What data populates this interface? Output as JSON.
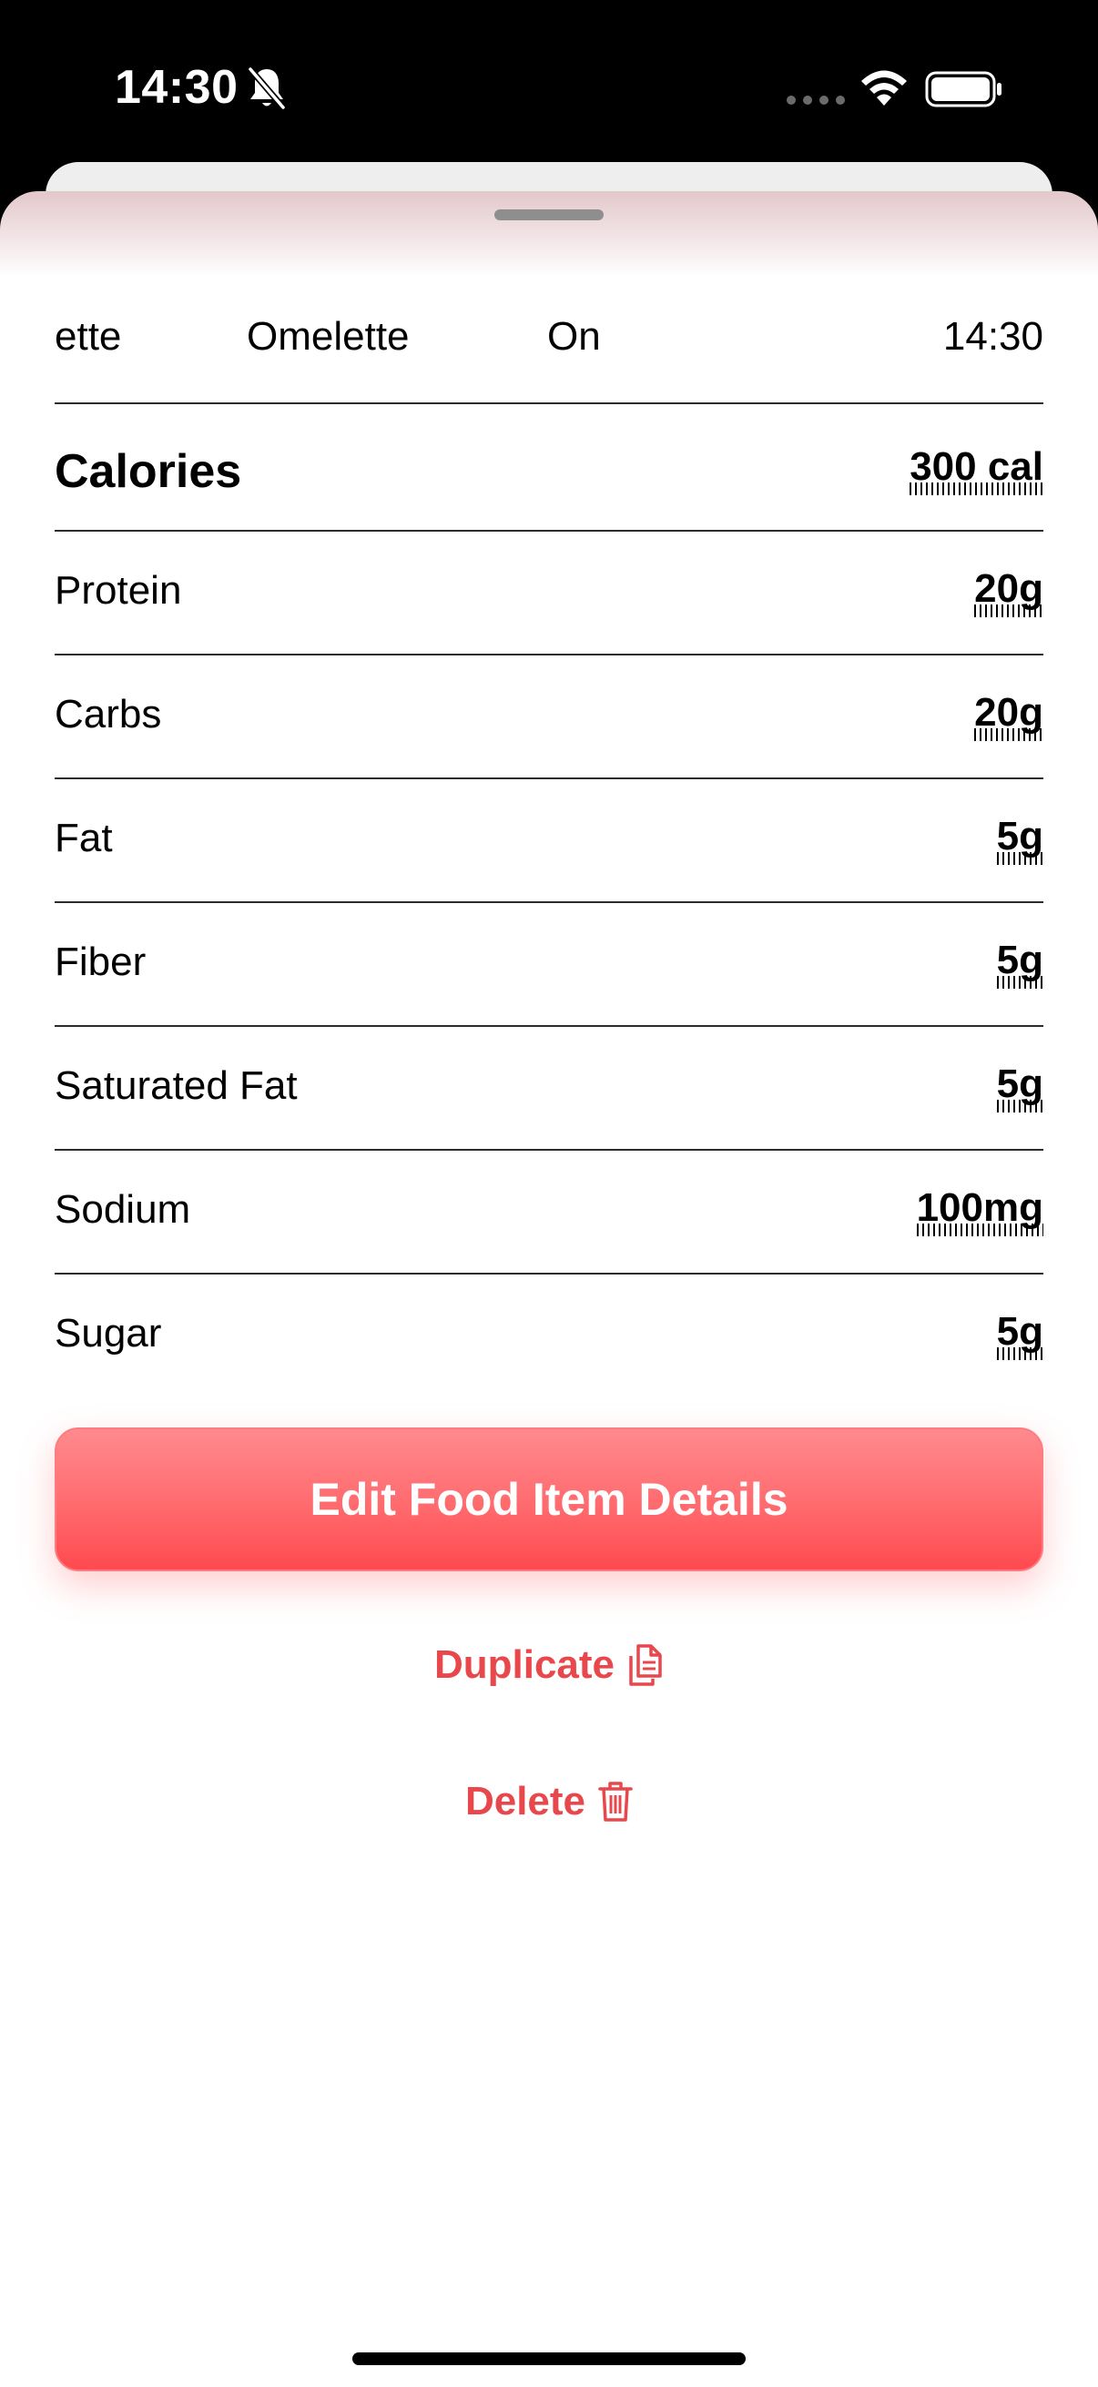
{
  "status_bar": {
    "time": "14:30",
    "icons": [
      "bell-slash-icon",
      "signal-dots-icon",
      "wifi-icon",
      "battery-icon"
    ]
  },
  "header": {
    "marquee": [
      "ette",
      "Omelette",
      "On"
    ],
    "time": "14:30"
  },
  "nutrients": [
    {
      "label": "Calories",
      "value": "300 cal"
    },
    {
      "label": "Protein",
      "value": "20g"
    },
    {
      "label": "Carbs",
      "value": "20g"
    },
    {
      "label": "Fat",
      "value": "5g"
    },
    {
      "label": "Fiber",
      "value": "5g"
    },
    {
      "label": "Saturated Fat",
      "value": "5g"
    },
    {
      "label": "Sodium",
      "value": "100mg"
    },
    {
      "label": "Sugar",
      "value": "5g"
    }
  ],
  "actions": {
    "edit_label": "Edit Food Item Details",
    "duplicate_label": "Duplicate",
    "delete_label": "Delete"
  },
  "colors": {
    "accent": "#e8474c",
    "button_top": "#ff8a8d",
    "button_bottom": "#ff4a4f"
  }
}
